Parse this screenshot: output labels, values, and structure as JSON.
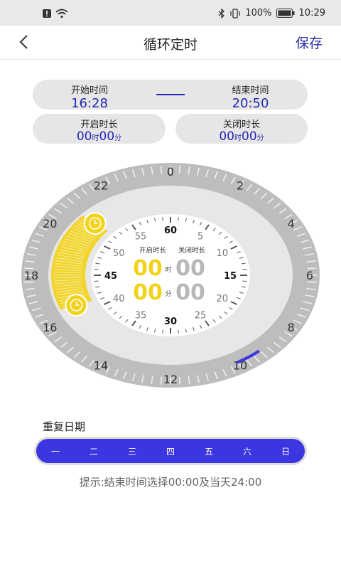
{
  "status": {
    "time": "10:29",
    "battery": "100%"
  },
  "nav": {
    "title": "循环定时",
    "save": "保存"
  },
  "time_range": {
    "start_label": "开始时间",
    "start_value": "16:28",
    "end_label": "结束时间",
    "end_value": "20:50"
  },
  "durations": {
    "on_label": "开启时长",
    "on_hours": "00",
    "on_hours_unit": "时",
    "on_minutes": "00",
    "on_minutes_unit": "分",
    "off_label": "关闭时长",
    "off_hours": "00",
    "off_hours_unit": "时",
    "off_minutes": "00",
    "off_minutes_unit": "分"
  },
  "dial": {
    "hour_labels": [
      "0",
      "2",
      "4",
      "6",
      "8",
      "10",
      "12",
      "14",
      "16",
      "18",
      "20",
      "22"
    ],
    "minute_labels": [
      "60",
      "5",
      "10",
      "15",
      "20",
      "25",
      "30",
      "35",
      "40",
      "45",
      "50",
      "55"
    ],
    "inner_on_label": "开启时长",
    "inner_off_label": "关闭时长",
    "inner_on_hours": "00",
    "inner_hours_unit": "时",
    "inner_off_hours": "00",
    "inner_on_minutes": "00",
    "inner_minutes_unit": "分",
    "inner_off_minutes": "00",
    "yellow_arc_start_hour": 16.47,
    "yellow_arc_end_hour": 20.83,
    "blue_arc_start_hour": 9.3,
    "blue_arc_end_hour": 10.0
  },
  "repeat": {
    "label": "重复日期",
    "days": [
      "一",
      "二",
      "三",
      "四",
      "五",
      "六",
      "日"
    ]
  },
  "hint": "提示:结束时间选择00:00及当天24:00",
  "colors": {
    "accent": "#3b36e0",
    "title_blue": "#2328b6",
    "yellow": "#f2d21a"
  }
}
